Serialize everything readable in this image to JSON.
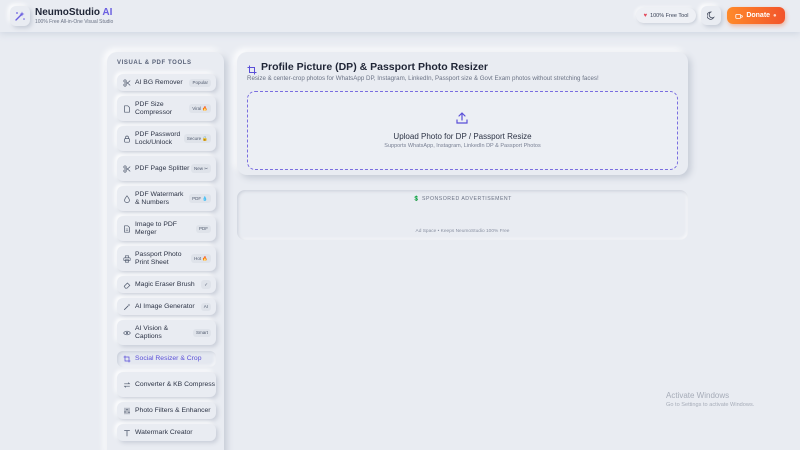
{
  "app": {
    "name": "NeumoStudio",
    "name_accent": "AI",
    "tagline": "100% Free All-in-One Visual Studio",
    "free_badge": "100% Free Tool",
    "donate_label": "Donate",
    "accent_color": "#6a5ee0",
    "donate_color": "#f46a2b"
  },
  "sidebar": {
    "title": "VISUAL & PDF TOOLS",
    "items": [
      {
        "label": "AI BG Remover",
        "badge": "Popular",
        "icon": "scissors-icon"
      },
      {
        "label": "PDF Size Compressor",
        "badge": "Viral 🔥",
        "icon": "file-icon"
      },
      {
        "label": "PDF Password Lock/Unlock",
        "badge": "Secure 🔒",
        "icon": "lock-icon"
      },
      {
        "label": "PDF Page Splitter",
        "badge": "New ✂",
        "icon": "split-icon"
      },
      {
        "label": "PDF Watermark & Numbers",
        "badge": "PDF 💧",
        "icon": "droplet-icon"
      },
      {
        "label": "Image to PDF Merger",
        "badge": "PDF",
        "icon": "document-icon"
      },
      {
        "label": "Passport Photo Print Sheet",
        "badge": "Hot 🔥",
        "icon": "printer-icon"
      },
      {
        "label": "Magic Eraser Brush",
        "badge": "✓",
        "icon": "eraser-icon"
      },
      {
        "label": "AI Image Generator",
        "badge": "AI",
        "icon": "wand-icon"
      },
      {
        "label": "AI Vision & Captions",
        "badge": "Smart",
        "icon": "eye-icon"
      },
      {
        "label": "Social Resizer & Crop",
        "badge": "",
        "icon": "crop-icon"
      },
      {
        "label": "Converter & KB Compress",
        "badge": "",
        "icon": "convert-icon"
      },
      {
        "label": "Photo Filters & Enhancer",
        "badge": "",
        "icon": "sliders-icon"
      },
      {
        "label": "Watermark Creator",
        "badge": "",
        "icon": "text-icon"
      }
    ]
  },
  "main": {
    "title": "Profile Picture (DP) & Passport Photo Resizer",
    "description": "Resize & center-crop photos for WhatsApp DP, Instagram, LinkedIn, Passport size & Govt Exam photos without stretching faces!",
    "upload_title": "Upload Photo for DP / Passport Resize",
    "upload_subtitle": "Supports WhatsApp, Instagram, LinkedIn DP & Passport Photos"
  },
  "ad": {
    "title": "💲 SPONSORED ADVERTISEMENT",
    "footer": "Ad Space • Keeps NeumoStudio 100% Free"
  },
  "os_overlay": {
    "title": "Activate Windows",
    "subtitle": "Go to Settings to activate Windows."
  }
}
